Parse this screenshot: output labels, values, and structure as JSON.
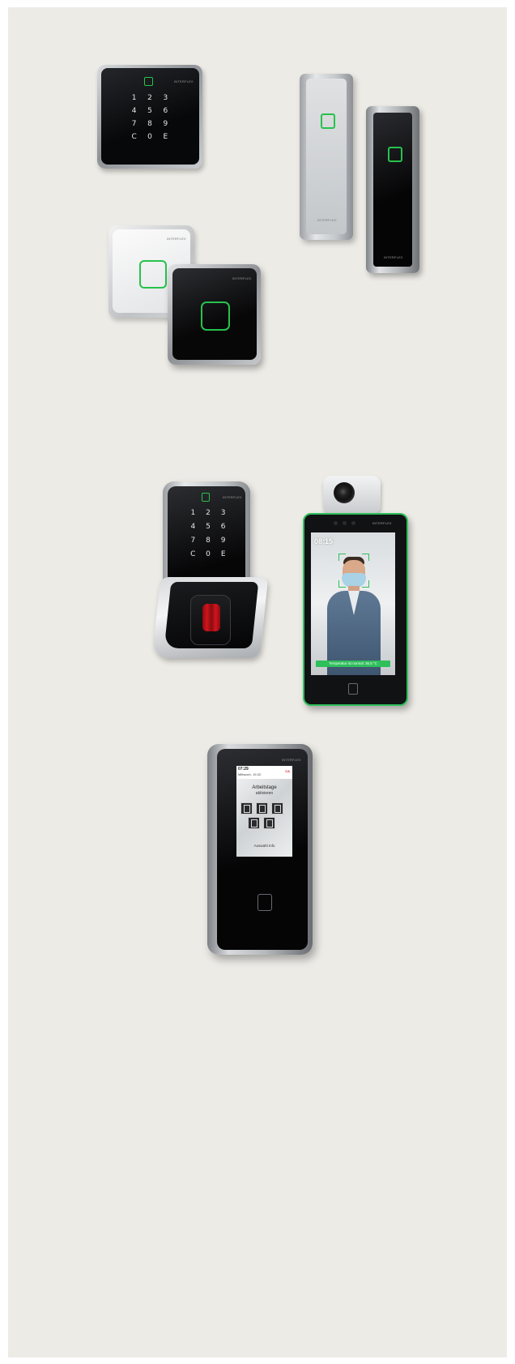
{
  "brand": "INTERFLEX",
  "colors": {
    "background": "#edebe6",
    "led_green": "#27c24c",
    "device_black": "#0d0d0f",
    "device_silver": "#b9bcc0"
  },
  "keypad_reader": {
    "keys": [
      "1",
      "2",
      "3",
      "4",
      "5",
      "6",
      "7",
      "8",
      "9",
      "C",
      "0",
      "E"
    ]
  },
  "slim_readers": {
    "count": 2
  },
  "square_readers": {
    "count": 2
  },
  "fingerprint_terminal": {
    "keys": [
      "1",
      "2",
      "3",
      "4",
      "5",
      "6",
      "7",
      "8",
      "9",
      "C",
      "0",
      "E"
    ]
  },
  "face_terminal": {
    "time": "08:15",
    "banner": "Temperatur ist normal: 36,5 °C"
  },
  "touch_terminal": {
    "time": "07:29",
    "date": "Mittwoch, 19.02.",
    "status": "CA",
    "heading_line1": "Arbeitstage",
    "heading_line2": "aktivieren",
    "footer": "Auswahl Info"
  }
}
